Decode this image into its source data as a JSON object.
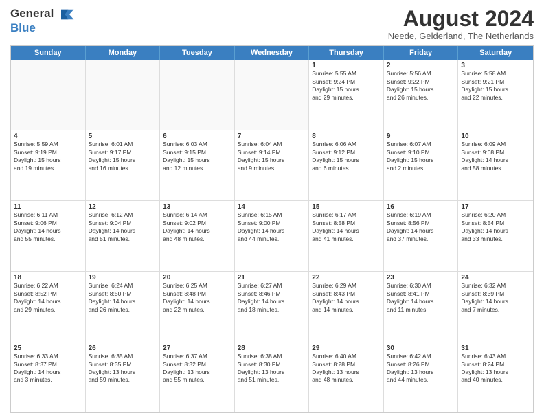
{
  "logo": {
    "general": "General",
    "blue": "Blue"
  },
  "title": "August 2024",
  "location": "Neede, Gelderland, The Netherlands",
  "days": [
    "Sunday",
    "Monday",
    "Tuesday",
    "Wednesday",
    "Thursday",
    "Friday",
    "Saturday"
  ],
  "rows": [
    [
      {
        "day": "",
        "text": "",
        "empty": true
      },
      {
        "day": "",
        "text": "",
        "empty": true
      },
      {
        "day": "",
        "text": "",
        "empty": true
      },
      {
        "day": "",
        "text": "",
        "empty": true
      },
      {
        "day": "1",
        "text": "Sunrise: 5:55 AM\nSunset: 9:24 PM\nDaylight: 15 hours\nand 29 minutes."
      },
      {
        "day": "2",
        "text": "Sunrise: 5:56 AM\nSunset: 9:22 PM\nDaylight: 15 hours\nand 26 minutes."
      },
      {
        "day": "3",
        "text": "Sunrise: 5:58 AM\nSunset: 9:21 PM\nDaylight: 15 hours\nand 22 minutes."
      }
    ],
    [
      {
        "day": "4",
        "text": "Sunrise: 5:59 AM\nSunset: 9:19 PM\nDaylight: 15 hours\nand 19 minutes."
      },
      {
        "day": "5",
        "text": "Sunrise: 6:01 AM\nSunset: 9:17 PM\nDaylight: 15 hours\nand 16 minutes."
      },
      {
        "day": "6",
        "text": "Sunrise: 6:03 AM\nSunset: 9:15 PM\nDaylight: 15 hours\nand 12 minutes."
      },
      {
        "day": "7",
        "text": "Sunrise: 6:04 AM\nSunset: 9:14 PM\nDaylight: 15 hours\nand 9 minutes."
      },
      {
        "day": "8",
        "text": "Sunrise: 6:06 AM\nSunset: 9:12 PM\nDaylight: 15 hours\nand 6 minutes."
      },
      {
        "day": "9",
        "text": "Sunrise: 6:07 AM\nSunset: 9:10 PM\nDaylight: 15 hours\nand 2 minutes."
      },
      {
        "day": "10",
        "text": "Sunrise: 6:09 AM\nSunset: 9:08 PM\nDaylight: 14 hours\nand 58 minutes."
      }
    ],
    [
      {
        "day": "11",
        "text": "Sunrise: 6:11 AM\nSunset: 9:06 PM\nDaylight: 14 hours\nand 55 minutes."
      },
      {
        "day": "12",
        "text": "Sunrise: 6:12 AM\nSunset: 9:04 PM\nDaylight: 14 hours\nand 51 minutes."
      },
      {
        "day": "13",
        "text": "Sunrise: 6:14 AM\nSunset: 9:02 PM\nDaylight: 14 hours\nand 48 minutes."
      },
      {
        "day": "14",
        "text": "Sunrise: 6:15 AM\nSunset: 9:00 PM\nDaylight: 14 hours\nand 44 minutes."
      },
      {
        "day": "15",
        "text": "Sunrise: 6:17 AM\nSunset: 8:58 PM\nDaylight: 14 hours\nand 41 minutes."
      },
      {
        "day": "16",
        "text": "Sunrise: 6:19 AM\nSunset: 8:56 PM\nDaylight: 14 hours\nand 37 minutes."
      },
      {
        "day": "17",
        "text": "Sunrise: 6:20 AM\nSunset: 8:54 PM\nDaylight: 14 hours\nand 33 minutes."
      }
    ],
    [
      {
        "day": "18",
        "text": "Sunrise: 6:22 AM\nSunset: 8:52 PM\nDaylight: 14 hours\nand 29 minutes."
      },
      {
        "day": "19",
        "text": "Sunrise: 6:24 AM\nSunset: 8:50 PM\nDaylight: 14 hours\nand 26 minutes."
      },
      {
        "day": "20",
        "text": "Sunrise: 6:25 AM\nSunset: 8:48 PM\nDaylight: 14 hours\nand 22 minutes."
      },
      {
        "day": "21",
        "text": "Sunrise: 6:27 AM\nSunset: 8:46 PM\nDaylight: 14 hours\nand 18 minutes."
      },
      {
        "day": "22",
        "text": "Sunrise: 6:29 AM\nSunset: 8:43 PM\nDaylight: 14 hours\nand 14 minutes."
      },
      {
        "day": "23",
        "text": "Sunrise: 6:30 AM\nSunset: 8:41 PM\nDaylight: 14 hours\nand 11 minutes."
      },
      {
        "day": "24",
        "text": "Sunrise: 6:32 AM\nSunset: 8:39 PM\nDaylight: 14 hours\nand 7 minutes."
      }
    ],
    [
      {
        "day": "25",
        "text": "Sunrise: 6:33 AM\nSunset: 8:37 PM\nDaylight: 14 hours\nand 3 minutes."
      },
      {
        "day": "26",
        "text": "Sunrise: 6:35 AM\nSunset: 8:35 PM\nDaylight: 13 hours\nand 59 minutes."
      },
      {
        "day": "27",
        "text": "Sunrise: 6:37 AM\nSunset: 8:32 PM\nDaylight: 13 hours\nand 55 minutes."
      },
      {
        "day": "28",
        "text": "Sunrise: 6:38 AM\nSunset: 8:30 PM\nDaylight: 13 hours\nand 51 minutes."
      },
      {
        "day": "29",
        "text": "Sunrise: 6:40 AM\nSunset: 8:28 PM\nDaylight: 13 hours\nand 48 minutes."
      },
      {
        "day": "30",
        "text": "Sunrise: 6:42 AM\nSunset: 8:26 PM\nDaylight: 13 hours\nand 44 minutes."
      },
      {
        "day": "31",
        "text": "Sunrise: 6:43 AM\nSunset: 8:24 PM\nDaylight: 13 hours\nand 40 minutes."
      }
    ]
  ]
}
